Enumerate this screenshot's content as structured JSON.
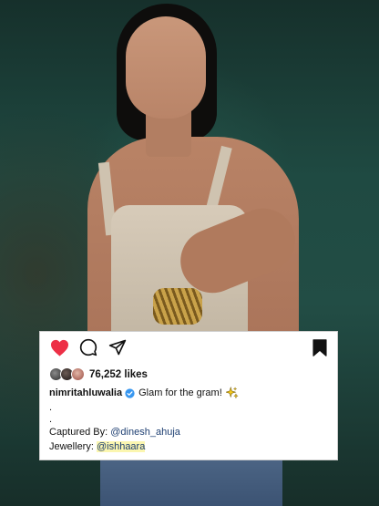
{
  "post": {
    "actions": {
      "like_icon": "heart-filled-icon",
      "comment_icon": "comment-icon",
      "share_icon": "paper-plane-icon",
      "save_icon": "bookmark-icon"
    },
    "likes": {
      "count_text": "76,252 likes"
    },
    "caption": {
      "username": "nimritahluwalia",
      "text": "Glam for the gram!",
      "dot1": ".",
      "dot2": "."
    },
    "credits": {
      "captured_label": "Captured By:",
      "captured_handle": "@dinesh_ahuja",
      "jewellery_label": "Jewellery:",
      "jewellery_handle": "@ishhaara"
    }
  },
  "colors": {
    "like_heart": "#ed2f46",
    "verified_badge": "#3897f0",
    "mention": "#1e3f72",
    "highlight": "#fbf6b0"
  }
}
